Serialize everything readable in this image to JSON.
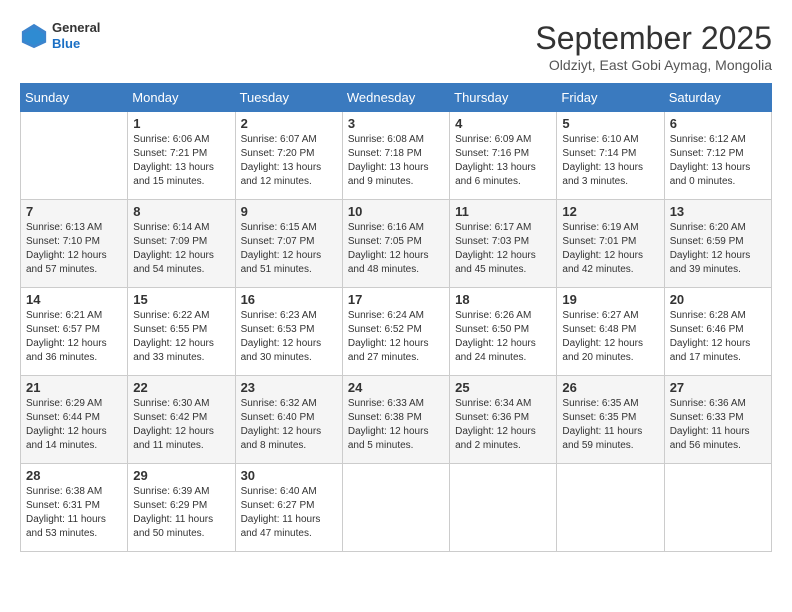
{
  "header": {
    "logo": {
      "general": "General",
      "blue": "Blue"
    },
    "title": "September 2025",
    "subtitle": "Oldziyt, East Gobi Aymag, Mongolia"
  },
  "weekdays": [
    "Sunday",
    "Monday",
    "Tuesday",
    "Wednesday",
    "Thursday",
    "Friday",
    "Saturday"
  ],
  "weeks": [
    [
      {
        "day": "",
        "sunrise": "",
        "sunset": "",
        "daylight": ""
      },
      {
        "day": "1",
        "sunrise": "Sunrise: 6:06 AM",
        "sunset": "Sunset: 7:21 PM",
        "daylight": "Daylight: 13 hours and 15 minutes."
      },
      {
        "day": "2",
        "sunrise": "Sunrise: 6:07 AM",
        "sunset": "Sunset: 7:20 PM",
        "daylight": "Daylight: 13 hours and 12 minutes."
      },
      {
        "day": "3",
        "sunrise": "Sunrise: 6:08 AM",
        "sunset": "Sunset: 7:18 PM",
        "daylight": "Daylight: 13 hours and 9 minutes."
      },
      {
        "day": "4",
        "sunrise": "Sunrise: 6:09 AM",
        "sunset": "Sunset: 7:16 PM",
        "daylight": "Daylight: 13 hours and 6 minutes."
      },
      {
        "day": "5",
        "sunrise": "Sunrise: 6:10 AM",
        "sunset": "Sunset: 7:14 PM",
        "daylight": "Daylight: 13 hours and 3 minutes."
      },
      {
        "day": "6",
        "sunrise": "Sunrise: 6:12 AM",
        "sunset": "Sunset: 7:12 PM",
        "daylight": "Daylight: 13 hours and 0 minutes."
      }
    ],
    [
      {
        "day": "7",
        "sunrise": "Sunrise: 6:13 AM",
        "sunset": "Sunset: 7:10 PM",
        "daylight": "Daylight: 12 hours and 57 minutes."
      },
      {
        "day": "8",
        "sunrise": "Sunrise: 6:14 AM",
        "sunset": "Sunset: 7:09 PM",
        "daylight": "Daylight: 12 hours and 54 minutes."
      },
      {
        "day": "9",
        "sunrise": "Sunrise: 6:15 AM",
        "sunset": "Sunset: 7:07 PM",
        "daylight": "Daylight: 12 hours and 51 minutes."
      },
      {
        "day": "10",
        "sunrise": "Sunrise: 6:16 AM",
        "sunset": "Sunset: 7:05 PM",
        "daylight": "Daylight: 12 hours and 48 minutes."
      },
      {
        "day": "11",
        "sunrise": "Sunrise: 6:17 AM",
        "sunset": "Sunset: 7:03 PM",
        "daylight": "Daylight: 12 hours and 45 minutes."
      },
      {
        "day": "12",
        "sunrise": "Sunrise: 6:19 AM",
        "sunset": "Sunset: 7:01 PM",
        "daylight": "Daylight: 12 hours and 42 minutes."
      },
      {
        "day": "13",
        "sunrise": "Sunrise: 6:20 AM",
        "sunset": "Sunset: 6:59 PM",
        "daylight": "Daylight: 12 hours and 39 minutes."
      }
    ],
    [
      {
        "day": "14",
        "sunrise": "Sunrise: 6:21 AM",
        "sunset": "Sunset: 6:57 PM",
        "daylight": "Daylight: 12 hours and 36 minutes."
      },
      {
        "day": "15",
        "sunrise": "Sunrise: 6:22 AM",
        "sunset": "Sunset: 6:55 PM",
        "daylight": "Daylight: 12 hours and 33 minutes."
      },
      {
        "day": "16",
        "sunrise": "Sunrise: 6:23 AM",
        "sunset": "Sunset: 6:53 PM",
        "daylight": "Daylight: 12 hours and 30 minutes."
      },
      {
        "day": "17",
        "sunrise": "Sunrise: 6:24 AM",
        "sunset": "Sunset: 6:52 PM",
        "daylight": "Daylight: 12 hours and 27 minutes."
      },
      {
        "day": "18",
        "sunrise": "Sunrise: 6:26 AM",
        "sunset": "Sunset: 6:50 PM",
        "daylight": "Daylight: 12 hours and 24 minutes."
      },
      {
        "day": "19",
        "sunrise": "Sunrise: 6:27 AM",
        "sunset": "Sunset: 6:48 PM",
        "daylight": "Daylight: 12 hours and 20 minutes."
      },
      {
        "day": "20",
        "sunrise": "Sunrise: 6:28 AM",
        "sunset": "Sunset: 6:46 PM",
        "daylight": "Daylight: 12 hours and 17 minutes."
      }
    ],
    [
      {
        "day": "21",
        "sunrise": "Sunrise: 6:29 AM",
        "sunset": "Sunset: 6:44 PM",
        "daylight": "Daylight: 12 hours and 14 minutes."
      },
      {
        "day": "22",
        "sunrise": "Sunrise: 6:30 AM",
        "sunset": "Sunset: 6:42 PM",
        "daylight": "Daylight: 12 hours and 11 minutes."
      },
      {
        "day": "23",
        "sunrise": "Sunrise: 6:32 AM",
        "sunset": "Sunset: 6:40 PM",
        "daylight": "Daylight: 12 hours and 8 minutes."
      },
      {
        "day": "24",
        "sunrise": "Sunrise: 6:33 AM",
        "sunset": "Sunset: 6:38 PM",
        "daylight": "Daylight: 12 hours and 5 minutes."
      },
      {
        "day": "25",
        "sunrise": "Sunrise: 6:34 AM",
        "sunset": "Sunset: 6:36 PM",
        "daylight": "Daylight: 12 hours and 2 minutes."
      },
      {
        "day": "26",
        "sunrise": "Sunrise: 6:35 AM",
        "sunset": "Sunset: 6:35 PM",
        "daylight": "Daylight: 11 hours and 59 minutes."
      },
      {
        "day": "27",
        "sunrise": "Sunrise: 6:36 AM",
        "sunset": "Sunset: 6:33 PM",
        "daylight": "Daylight: 11 hours and 56 minutes."
      }
    ],
    [
      {
        "day": "28",
        "sunrise": "Sunrise: 6:38 AM",
        "sunset": "Sunset: 6:31 PM",
        "daylight": "Daylight: 11 hours and 53 minutes."
      },
      {
        "day": "29",
        "sunrise": "Sunrise: 6:39 AM",
        "sunset": "Sunset: 6:29 PM",
        "daylight": "Daylight: 11 hours and 50 minutes."
      },
      {
        "day": "30",
        "sunrise": "Sunrise: 6:40 AM",
        "sunset": "Sunset: 6:27 PM",
        "daylight": "Daylight: 11 hours and 47 minutes."
      },
      {
        "day": "",
        "sunrise": "",
        "sunset": "",
        "daylight": ""
      },
      {
        "day": "",
        "sunrise": "",
        "sunset": "",
        "daylight": ""
      },
      {
        "day": "",
        "sunrise": "",
        "sunset": "",
        "daylight": ""
      },
      {
        "day": "",
        "sunrise": "",
        "sunset": "",
        "daylight": ""
      }
    ]
  ]
}
